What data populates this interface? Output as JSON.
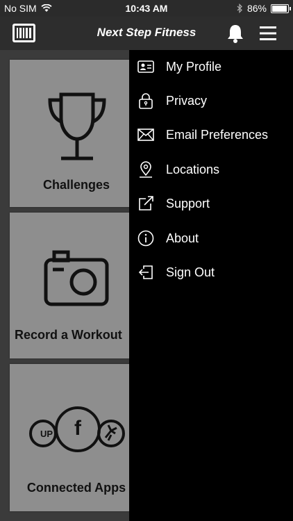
{
  "status_bar": {
    "carrier": "No SIM",
    "time": "10:43 AM",
    "battery": "86%",
    "battery_level": 0.86
  },
  "header": {
    "title": "Next Step Fitness",
    "left_icon": "barcode-icon",
    "bell_icon": "bell-icon",
    "menu_icon": "hamburger-menu-icon"
  },
  "tiles": [
    {
      "label": "Challenges",
      "icon": "trophy-icon"
    },
    {
      "label": "Record a Workout",
      "icon": "camera-icon"
    },
    {
      "label": "Connected Apps",
      "icon": "connected-apps-icon"
    }
  ],
  "connected_apps_icon_text": {
    "left": "UP",
    "center": "f"
  },
  "side_menu": {
    "items": [
      {
        "label": "My Profile",
        "icon": "id-card-icon"
      },
      {
        "label": "Privacy",
        "icon": "lock-icon"
      },
      {
        "label": "Email Preferences",
        "icon": "envelope-icon"
      },
      {
        "label": "Locations",
        "icon": "map-pin-icon"
      },
      {
        "label": "Support",
        "icon": "external-link-icon"
      },
      {
        "label": "About",
        "icon": "info-icon"
      },
      {
        "label": "Sign Out",
        "icon": "sign-out-icon"
      }
    ]
  },
  "colors": {
    "header_bg": "#2d2d2d",
    "menu_bg": "#000000",
    "tile_bg": "#8e8e8e",
    "text_light": "#ffffff"
  }
}
